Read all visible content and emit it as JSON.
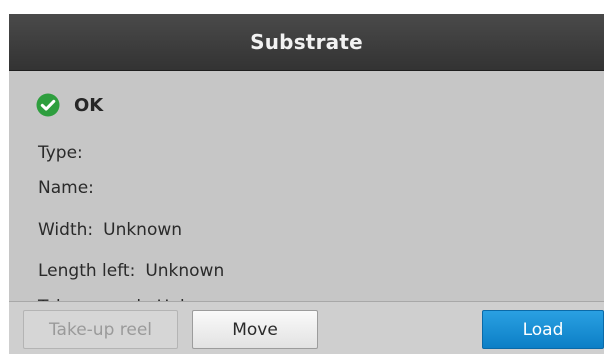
{
  "title": "Substrate",
  "status": {
    "icon": "check-circle-icon",
    "text": "OK",
    "color": "#2e9e3e"
  },
  "info": {
    "type_label": "Type:",
    "type_value": "",
    "name_label": "Name:",
    "name_value": "",
    "width_label": "Width:",
    "width_value": "Unknown",
    "length_label": "Length left:",
    "length_value": "Unknown",
    "partial_label": "Take-up reel:",
    "partial_value": "Unknown"
  },
  "buttons": {
    "takeup": "Take-up reel",
    "move": "Move",
    "load": "Load"
  },
  "colors": {
    "title_bar": "#3c3c3c",
    "background": "#c6c6c6",
    "accent": "#1a8fd6"
  }
}
